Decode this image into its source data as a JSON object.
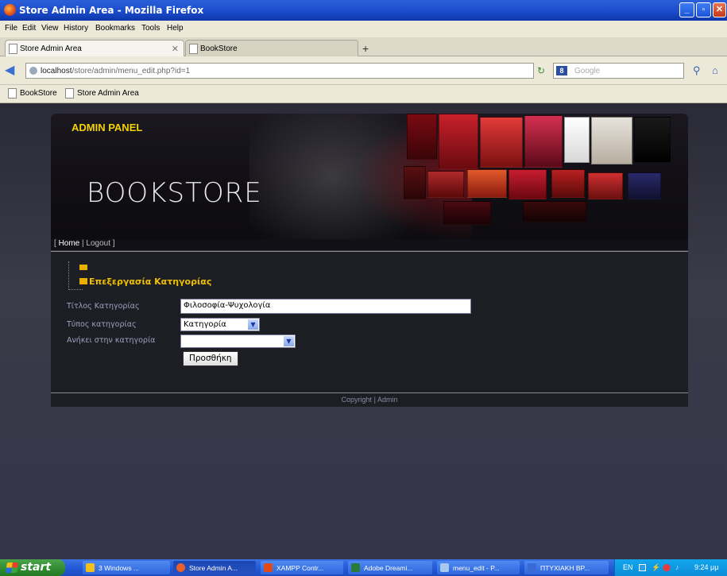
{
  "window": {
    "title": "Store Admin Area - Mozilla Firefox"
  },
  "menu": [
    "File",
    "Edit",
    "View",
    "History",
    "Bookmarks",
    "Tools",
    "Help"
  ],
  "tabs": [
    {
      "label": "Store Admin Area"
    },
    {
      "label": "BookStore"
    }
  ],
  "nav": {
    "url_host": "localhost",
    "url_path": "/store/admin/menu_edit.php?id=1",
    "search_placeholder": "Google"
  },
  "bookmarks": [
    "BookStore",
    "Store Admin Area"
  ],
  "site": {
    "admin_panel": "ADMIN PANEL",
    "brand": "BOOKSTORE",
    "nav_home": "Home",
    "nav_logout": "Logout",
    "nav_sep": "|",
    "nav_open": "[",
    "nav_close": "]"
  },
  "form": {
    "section_title": "Επεξεργασία Κατηγορίας",
    "title_label": "Τίτλος Κατηγορίας",
    "title_value": "Φιλοσοφία-Ψυχολογία",
    "type_label": "Τύπος κατηγορίας",
    "type_value": "Κατηγορία",
    "parent_label": "Ανήκει στην κατηγορία",
    "parent_value": "",
    "submit_label": "Προσθήκη"
  },
  "footer": {
    "copyright": "Copyright",
    "admin": "Admin",
    "sep": "|"
  },
  "taskbar": {
    "start_label": "start",
    "buttons": [
      "3 Windows ...",
      "Store Admin A...",
      "XAMPP Contr...",
      "Adobe Dreami...",
      "menu_edit - P...",
      "ΠΤΥΧΙΑΚΗ ΒΡ..."
    ],
    "tray_lang": "EN",
    "tray_time": "9:24 μμ"
  }
}
